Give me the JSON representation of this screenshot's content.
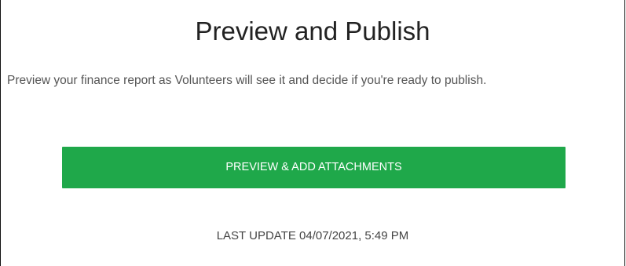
{
  "page": {
    "title": "Preview and Publish",
    "description": "Preview your finance report as Volunteers will see it and decide if you're ready to publish.",
    "primary_button_label": "PREVIEW & ADD ATTACHMENTS",
    "last_update": "LAST UPDATE 04/07/2021, 5:49 PM"
  },
  "colors": {
    "primary_button_bg": "#1fa84a",
    "primary_button_text": "#ffffff",
    "title_text": "#222222",
    "body_text": "#555555"
  }
}
